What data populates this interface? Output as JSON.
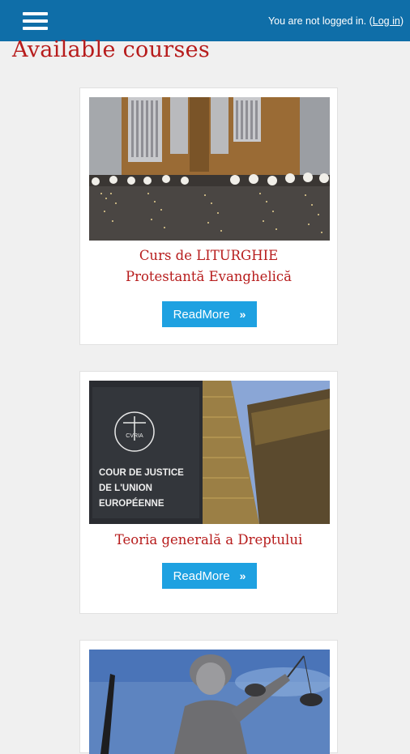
{
  "header": {
    "login_prefix": "You are not logged in. (",
    "login_link": "Log in",
    "login_suffix": ")"
  },
  "page_title": "Available courses",
  "courses": [
    {
      "title_line1": "Curs de LITURGHIE",
      "title_line2": "Protestantă Evanghelică",
      "button": "ReadMore"
    },
    {
      "title_line1": "Teoria generală a Dreptului",
      "button": "ReadMore"
    },
    {
      "title_line1": ""
    }
  ],
  "images": {
    "court_sign": [
      "COUR DE JUSTICE",
      "DE L'UNION",
      "EUROPÉENNE"
    ],
    "court_seal": "CVRIA"
  },
  "icons": {
    "menu": "hamburger-menu-icon",
    "chevron": "double-chevron-right-icon"
  },
  "colors": {
    "header_bg": "#0f6ea8",
    "title_red": "#b71c1c",
    "button_blue": "#1ea1e1",
    "page_bg": "#f0f0f0"
  }
}
